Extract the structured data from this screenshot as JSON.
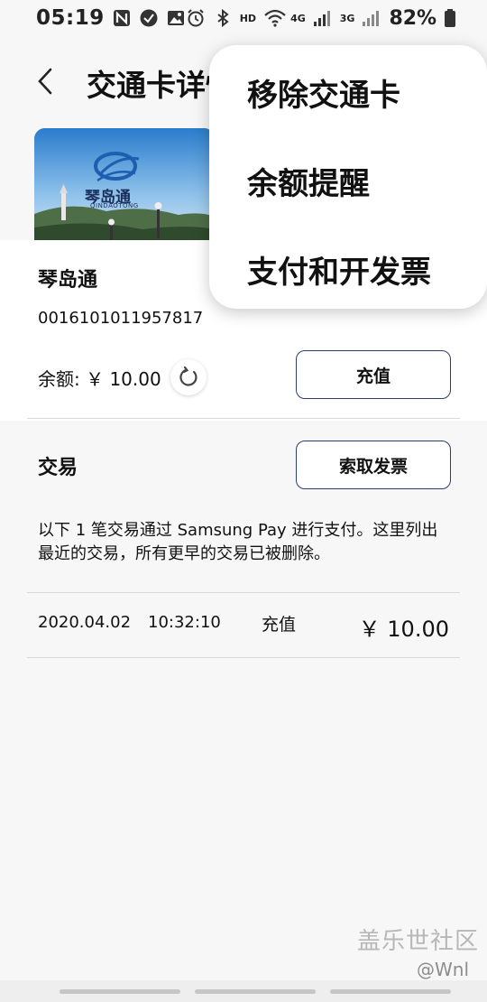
{
  "status_bar": {
    "time": "05:19",
    "network_hd": "HD",
    "network_4g": "4G",
    "network_3g": "3G",
    "battery": "82%",
    "icons": [
      "n-app-icon",
      "sync-check-icon",
      "image-icon",
      "alarm-icon",
      "bluetooth-icon",
      "wifi-icon",
      "signal-icon",
      "battery-icon"
    ]
  },
  "header": {
    "title": "交通卡详情",
    "back_icon": "chevron-left-icon"
  },
  "card": {
    "logo_text": "琴岛通",
    "logo_sub": "QINDAOTONG",
    "name": "琴岛通",
    "number": "0016101011957817",
    "balance_label": "余额: ￥ 10.00",
    "recharge_button": "充值"
  },
  "transactions": {
    "title": "交易",
    "invoice_button": "索取发票",
    "notice": "以下 1 笔交易通过 Samsung Pay 进行支付。这里列出最近的交易，所有更早的交易已被删除。",
    "rows": [
      {
        "date": "2020.04.02",
        "time": "10:32:10",
        "type": "充值",
        "amount": "￥ 10.00"
      }
    ]
  },
  "popup_menu": {
    "items": [
      "移除交通卡",
      "余额提醒",
      "支付和开发票"
    ]
  },
  "watermark": {
    "main": "盖乐世社区",
    "sub": "@Wnl"
  },
  "colors": {
    "button_border": "#2c3e6b",
    "background": "#f7f7f7",
    "divider": "#d9d9d9"
  }
}
